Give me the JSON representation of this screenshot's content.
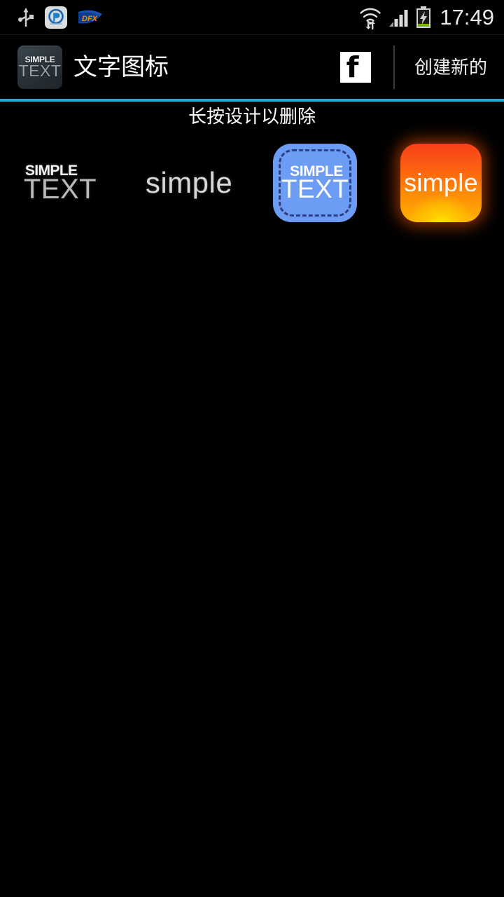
{
  "status_bar": {
    "icons_left": [
      "usb-icon",
      "pico-app-icon",
      "dfx-audio-icon"
    ],
    "pico_label": "P",
    "dfx_label": "DFX",
    "icons_right": [
      "wifi-icon",
      "signal-icon",
      "battery-charging-icon"
    ],
    "clock": "17:49"
  },
  "action_bar": {
    "app_icon": {
      "line1": "SIMPLE",
      "line2": "TEXT"
    },
    "title": "文字图标",
    "facebook_label": "f",
    "create_new_label": "创建新的"
  },
  "content": {
    "hint": "长按设计以删除",
    "designs": [
      {
        "id": "design-plain-simple-text",
        "style": "plain",
        "line1": "SIMPLE",
        "line2": "TEXT",
        "background": "#000000",
        "text_color": "#f4f4f4"
      },
      {
        "id": "design-plain-lowercase",
        "style": "lowercase",
        "line1": "simple",
        "background": "#000000",
        "text_color": "#d8d8d8"
      },
      {
        "id": "design-blue-dashed",
        "style": "blue-icon",
        "line1": "SIMPLE",
        "line2": "TEXT",
        "background": "#6d9cf4",
        "border_color": "#2c3f84",
        "text_color": "#ffffff"
      },
      {
        "id": "design-orange-gradient",
        "style": "orange-icon",
        "line1": "simple",
        "background_from": "#f9401a",
        "background_to": "#ffe800",
        "text_color": "#ffffff"
      }
    ]
  },
  "colors": {
    "accent": "#2da5dc",
    "background": "#000000",
    "status_text": "#e8e8e8"
  }
}
